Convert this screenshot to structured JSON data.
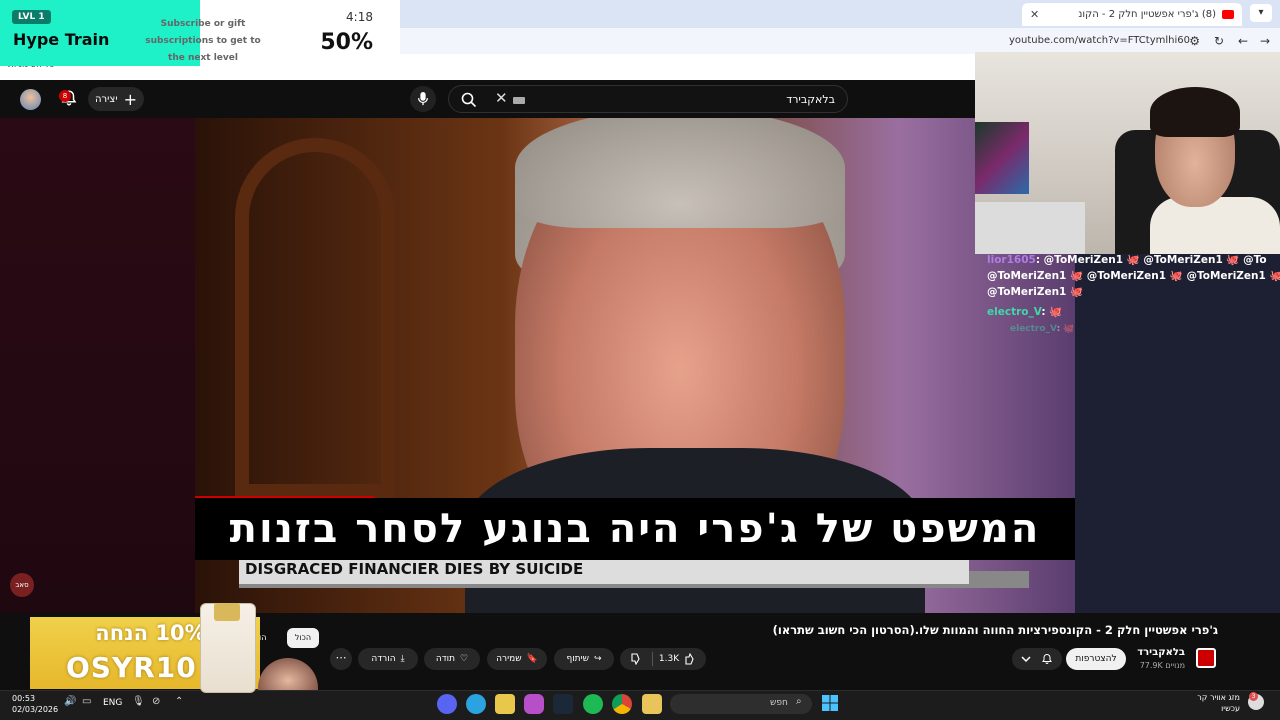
{
  "browser": {
    "tab_title": "(8) ג'פרי אפשטיין חלק 2 - הקונ",
    "url": "youtube.com/watch?v=FTCtymlhi60",
    "bookmark": "כל הסימניות"
  },
  "hype_train": {
    "level": "LVL 1",
    "title": "Hype Train",
    "subtitle": "Subscribe or gift subscriptions to get to the next level",
    "time": "4:18",
    "percent": "50%",
    "progress_fraction": 0.5
  },
  "youtube_header": {
    "notification_count": "8",
    "create_label": "יצירה",
    "search_query": "בלאקבירד"
  },
  "video": {
    "subtitle_text": "המשפט של ג'פרי היה בנוגע לסחר בזנות",
    "news_ticker": "DISGRACED FINANCIER DIES BY SUICIDE"
  },
  "side": {
    "channel_badge": "סאב"
  },
  "stream_chat": {
    "messages": [
      {
        "user": "lior1605",
        "text": ": @ToMeriZen1 🐙 @ToMeriZen1 🐙 @To"
      },
      {
        "user": "",
        "text": "@ToMeriZen1 🐙 @ToMeriZen1 🐙 @ToMeriZen1 🐙 @To"
      },
      {
        "user": "",
        "text": "@ToMeriZen1 🐙"
      },
      {
        "user": "electro_V",
        "text": ": 🐙"
      },
      {
        "user": "electro_V",
        "text": ": 🐙"
      }
    ]
  },
  "video_info": {
    "title": "ג'פרי אפשטיין חלק 2 - הקונספירציות החווה והמוות שלו.(הסרטון הכי חשוב שתראו)",
    "channel_name": "בלאקבירד",
    "subscribers": "77.9K מנויים",
    "subscribe_label": "להצטרפות",
    "like_count": "1.3K",
    "share_label": "שיתוף",
    "save_label": "שמירה",
    "thanks_label": "תודה",
    "download_label": "הורדה",
    "chip_all": "הכול",
    "chip_partial": "הוע"
  },
  "promo": {
    "line1": "קוד 10% הנחה",
    "line2": "OSYR10"
  },
  "taskbar": {
    "time": "00:53",
    "date": "02/03/2026",
    "language": "ENG",
    "search_placeholder": "חפש",
    "weather_line1": "מזג אוויר קר",
    "weather_line2": "עכשיו",
    "notification_badge": "3"
  }
}
